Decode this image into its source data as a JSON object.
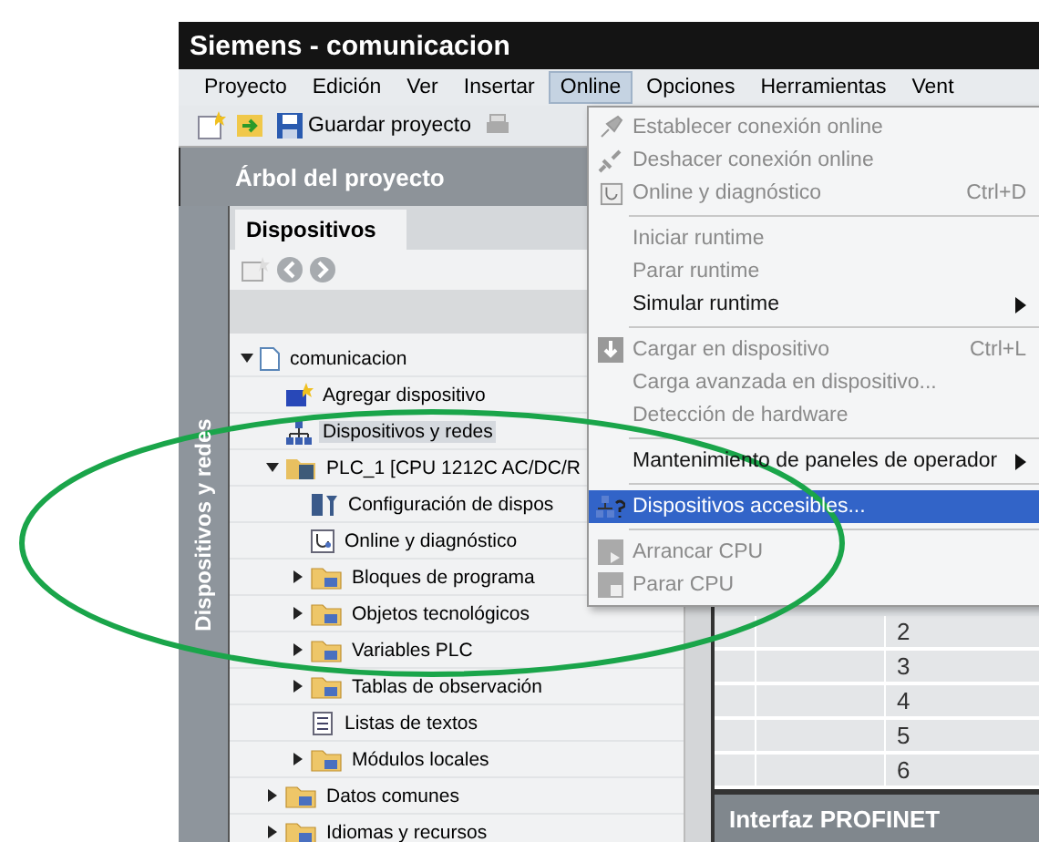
{
  "window": {
    "title": "Siemens - comunicacion"
  },
  "menu_bar": [
    {
      "label": "Proyecto",
      "selected": false
    },
    {
      "label": "Edición",
      "selected": false
    },
    {
      "label": "Ver",
      "selected": false
    },
    {
      "label": "Insertar",
      "selected": false
    },
    {
      "label": "Online",
      "selected": true
    },
    {
      "label": "Opciones",
      "selected": false
    },
    {
      "label": "Herramientas",
      "selected": false
    },
    {
      "label": "Vent",
      "selected": false
    }
  ],
  "toolbar": {
    "save_label": "Guardar proyecto"
  },
  "project_tree": {
    "title": "Árbol del proyecto",
    "side_tab": "Dispositivos y redes",
    "tab": "Dispositivos",
    "items": [
      {
        "label": "comunicacion",
        "kind": "project",
        "expanded": true,
        "selected": false,
        "children": [
          {
            "label": "Agregar dispositivo",
            "kind": "add",
            "selected": false
          },
          {
            "label": "Dispositivos y redes",
            "kind": "network",
            "selected": true
          },
          {
            "label": "PLC_1 [CPU 1212C AC/DC/R",
            "kind": "plc",
            "expanded": true,
            "selected": false,
            "children": [
              {
                "label": "Configuración de dispos",
                "kind": "config",
                "selected": false
              },
              {
                "label": "Online y diagnóstico",
                "kind": "diag",
                "selected": false
              },
              {
                "label": "Bloques de programa",
                "kind": "folder",
                "expanded": false,
                "selected": false
              },
              {
                "label": "Objetos tecnológicos",
                "kind": "folder",
                "expanded": false,
                "selected": false
              },
              {
                "label": "Variables PLC",
                "kind": "folder",
                "expanded": false,
                "selected": false
              },
              {
                "label": "Tablas de observación",
                "kind": "folder",
                "expanded": false,
                "selected": false
              },
              {
                "label": "Listas de textos",
                "kind": "list",
                "selected": false
              },
              {
                "label": "Módulos locales",
                "kind": "folder",
                "expanded": false,
                "selected": false
              }
            ]
          },
          {
            "label": "Datos comunes",
            "kind": "folder",
            "expanded": false,
            "selected": false
          },
          {
            "label": "Idiomas y recursos",
            "kind": "folder",
            "expanded": false,
            "selected": false
          }
        ]
      }
    ]
  },
  "online_menu": [
    {
      "kind": "item",
      "label": "Establecer conexión online",
      "disabled": true,
      "selected": false
    },
    {
      "kind": "item",
      "label": "Deshacer conexión online",
      "disabled": true,
      "selected": false
    },
    {
      "kind": "item",
      "label": "Online y diagnóstico",
      "shortcut": "Ctrl+D",
      "disabled": true,
      "selected": false
    },
    {
      "kind": "separator"
    },
    {
      "kind": "item",
      "label": "Iniciar runtime",
      "disabled": true,
      "selected": false
    },
    {
      "kind": "item",
      "label": "Parar runtime",
      "disabled": true,
      "selected": false
    },
    {
      "kind": "item",
      "label": "Simular runtime",
      "disabled": false,
      "submenu": true,
      "selected": false
    },
    {
      "kind": "separator"
    },
    {
      "kind": "item",
      "label": "Cargar en dispositivo",
      "shortcut": "Ctrl+L",
      "disabled": true,
      "selected": false
    },
    {
      "kind": "item",
      "label": "Carga avanzada en dispositivo...",
      "disabled": true,
      "selected": false
    },
    {
      "kind": "item",
      "label": "Detección de hardware",
      "disabled": true,
      "selected": false
    },
    {
      "kind": "separator"
    },
    {
      "kind": "item",
      "label": "Mantenimiento de paneles de operador",
      "disabled": false,
      "submenu": true,
      "selected": false
    },
    {
      "kind": "separator"
    },
    {
      "kind": "item",
      "label": "Dispositivos accesibles...",
      "disabled": false,
      "selected": true
    },
    {
      "kind": "separator"
    },
    {
      "kind": "item",
      "label": "Arrancar CPU",
      "disabled": true,
      "selected": false
    },
    {
      "kind": "item",
      "label": "Parar CPU",
      "disabled": true,
      "selected": false
    }
  ],
  "table": {
    "rows": [
      "2",
      "3",
      "4",
      "5",
      "6"
    ]
  },
  "bottom_panel": {
    "title": "Interfaz PROFINET"
  }
}
